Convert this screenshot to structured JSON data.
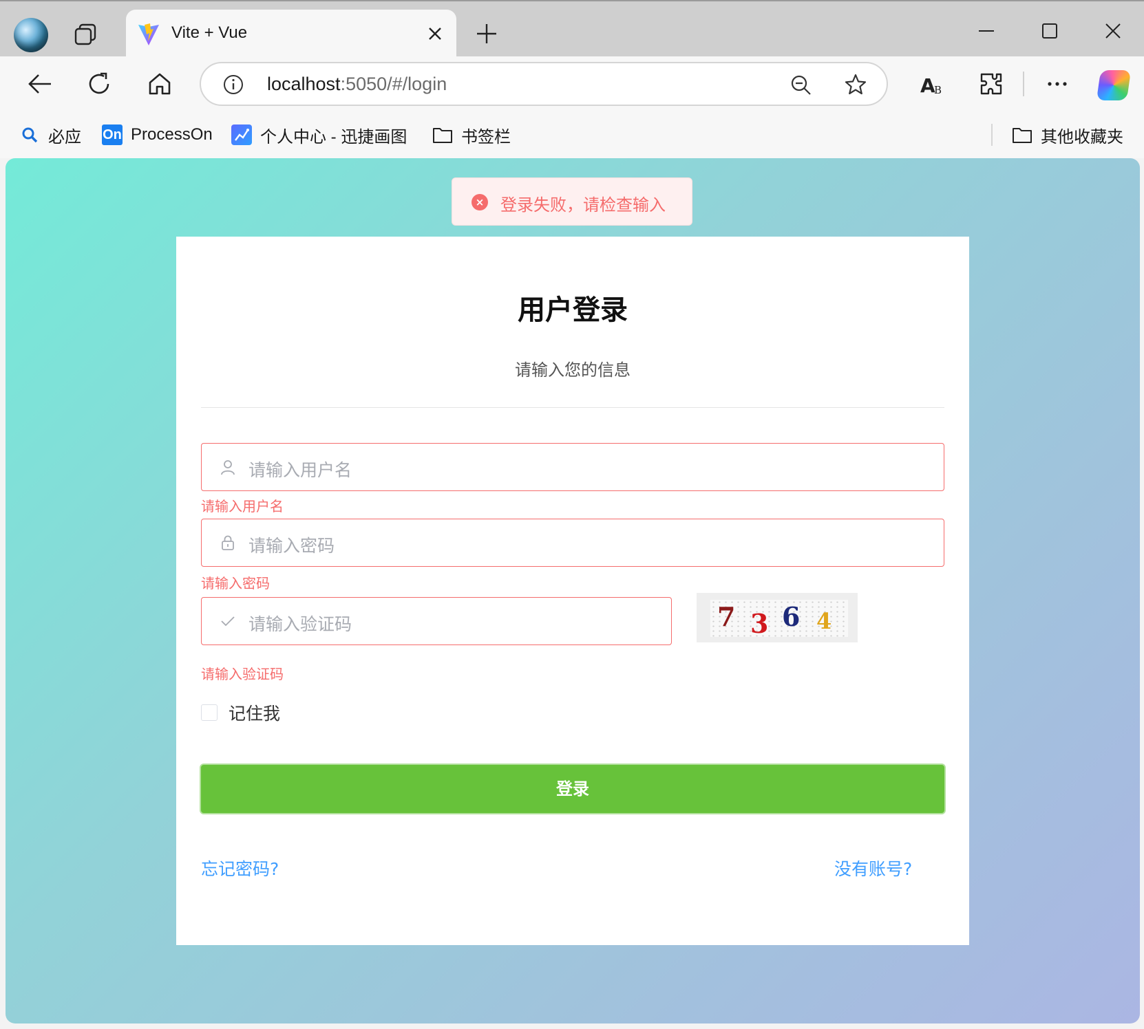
{
  "browser": {
    "tab_title": "Vite + Vue",
    "url_host": "localhost",
    "url_rest": ":5050/#/login",
    "bookmarks": [
      {
        "label": "必应",
        "icon": "search-icon"
      },
      {
        "label": "ProcessOn",
        "icon": "processon-logo",
        "badge": "On"
      },
      {
        "label": "个人中心 - 迅捷画图",
        "icon": "chart-app-icon"
      },
      {
        "label": "书签栏",
        "icon": "folder-icon"
      }
    ],
    "other_bookmarks": "其他收藏夹"
  },
  "toast": {
    "message": "登录失败，请检查输入",
    "icon_glyph": "×",
    "type": "error",
    "color": "#f56c6c"
  },
  "login": {
    "title": "用户登录",
    "subtitle": "请输入您的信息",
    "username_placeholder": "请输入用户名",
    "username_error": "请输入用户名",
    "password_placeholder": "请输入密码",
    "password_error": "请输入密码",
    "captcha_placeholder": "请输入验证码",
    "captcha_error": "请输入验证码",
    "captcha_digits": [
      "7",
      "3",
      "6",
      "4"
    ],
    "remember_label": "记住我",
    "remember_checked": false,
    "submit_label": "登录",
    "forgot_link": "忘记密码?",
    "register_link": "没有账号?"
  },
  "colors": {
    "error": "#f56c6c",
    "primary_button": "#67c23a",
    "link": "#409eff",
    "captcha_digits": [
      "#8b1a1a",
      "#d0191d",
      "#1d2a7a",
      "#e0a51c"
    ]
  }
}
